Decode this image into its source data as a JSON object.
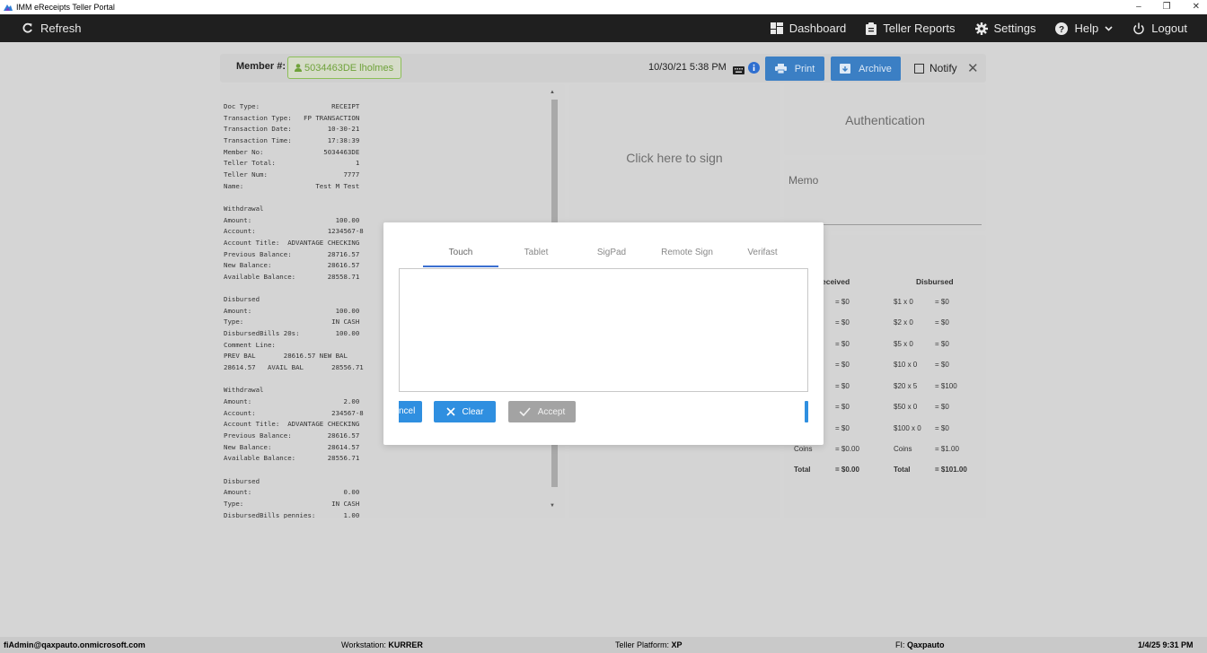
{
  "window": {
    "title": "IMM eReceipts Teller Portal",
    "controls": [
      "–",
      "❐",
      "✕"
    ]
  },
  "nav": {
    "refresh": "Refresh",
    "dashboard": "Dashboard",
    "teller_reports": "Teller Reports",
    "settings": "Settings",
    "help": "Help",
    "logout": "Logout"
  },
  "member_bar": {
    "label": "Member #:",
    "member_value": "5034463DE lholmes",
    "datetime": "10/30/21 5:38 PM",
    "print": "Print",
    "archive": "Archive",
    "notify": "Notify",
    "close": "✕"
  },
  "receipt_text": "Doc Type:                  RECEIPT\nTransaction Type:   FP TRANSACTION\nTransaction Date:         10-30-21\nTransaction Time:         17:38:39\nMember No:               5034463DE\nTeller Total:                    1\nTeller Num:                   7777\nName:                  Test M Test\n\nWithdrawal\nAmount:                     100.00\nAccount:                  1234567-8\nAccount Title:  ADVANTAGE CHECKING\nPrevious Balance:         28716.57\nNew Balance:              28616.57\nAvailable Balance:        28558.71\n\nDisbursed\nAmount:                     100.00\nType:                      IN CASH\nDisbursedBills 20s:         100.00\nComment Line:\nPREV BAL       28616.57 NEW BAL\n28614.57   AVAIL BAL       28556.71\n\nWithdrawal\nAmount:                       2.00\nAccount:                   234567-8\nAccount Title:  ADVANTAGE CHECKING\nPrevious Balance:         28616.57\nNew Balance:              28614.57\nAvailable Balance:        28556.71\n\nDisbursed\nAmount:                       0.00\nType:                      IN CASH\nDisbursedBills pennies:       1.00",
  "sign_panel": {
    "prompt": "Click here to sign"
  },
  "auth_panel": {
    "title": "Authentication"
  },
  "memo_panel": {
    "label": "Memo"
  },
  "cash": {
    "received_header": "eceived",
    "disbursed_header": "Disbursed",
    "received_rows": [
      "= $0",
      "= $0",
      "= $0",
      "= $0",
      "= $0",
      "= $0",
      "= $0"
    ],
    "disbursed_rows": [
      {
        "denom": "$1 x 0",
        "value": "= $0"
      },
      {
        "denom": "$2 x 0",
        "value": "= $0"
      },
      {
        "denom": "$5 x 0",
        "value": "= $0"
      },
      {
        "denom": "$10 x 0",
        "value": "= $0"
      },
      {
        "denom": "$20 x 5",
        "value": "= $100"
      },
      {
        "denom": "$50 x 0",
        "value": "= $0"
      },
      {
        "denom": "$100 x 0",
        "value": "= $0"
      }
    ],
    "coins_label": "Coins",
    "coins_received": "= $0.00",
    "coins_disbursed_label": "Coins",
    "coins_disbursed": "= $1.00",
    "total_label": "Total",
    "total_received": "= $0.00",
    "total_disbursed_label": "Total",
    "total_disbursed": "= $101.00"
  },
  "modal": {
    "tabs": [
      "Touch",
      "Tablet",
      "SigPad",
      "Remote Sign",
      "Verifast"
    ],
    "active_tab": "Touch",
    "cancel": "ncel",
    "clear": "Clear",
    "accept": "Accept"
  },
  "footer": {
    "user": "fiAdmin@qaxpauto.onmicrosoft.com",
    "workstation_label": "Workstation:",
    "workstation": "KURRER",
    "platform_label": "Teller Platform:",
    "platform": "XP",
    "fi_label": "FI:",
    "fi": "Qaxpauto",
    "datetime": "1/4/25 9:31 PM"
  },
  "colors": {
    "nav_bg": "#1f1f1f",
    "primary": "#3b7fc4",
    "modal_primary": "#2f8fe0",
    "member_green": "#6fa23a",
    "tab_underline": "#3a6fd0"
  }
}
